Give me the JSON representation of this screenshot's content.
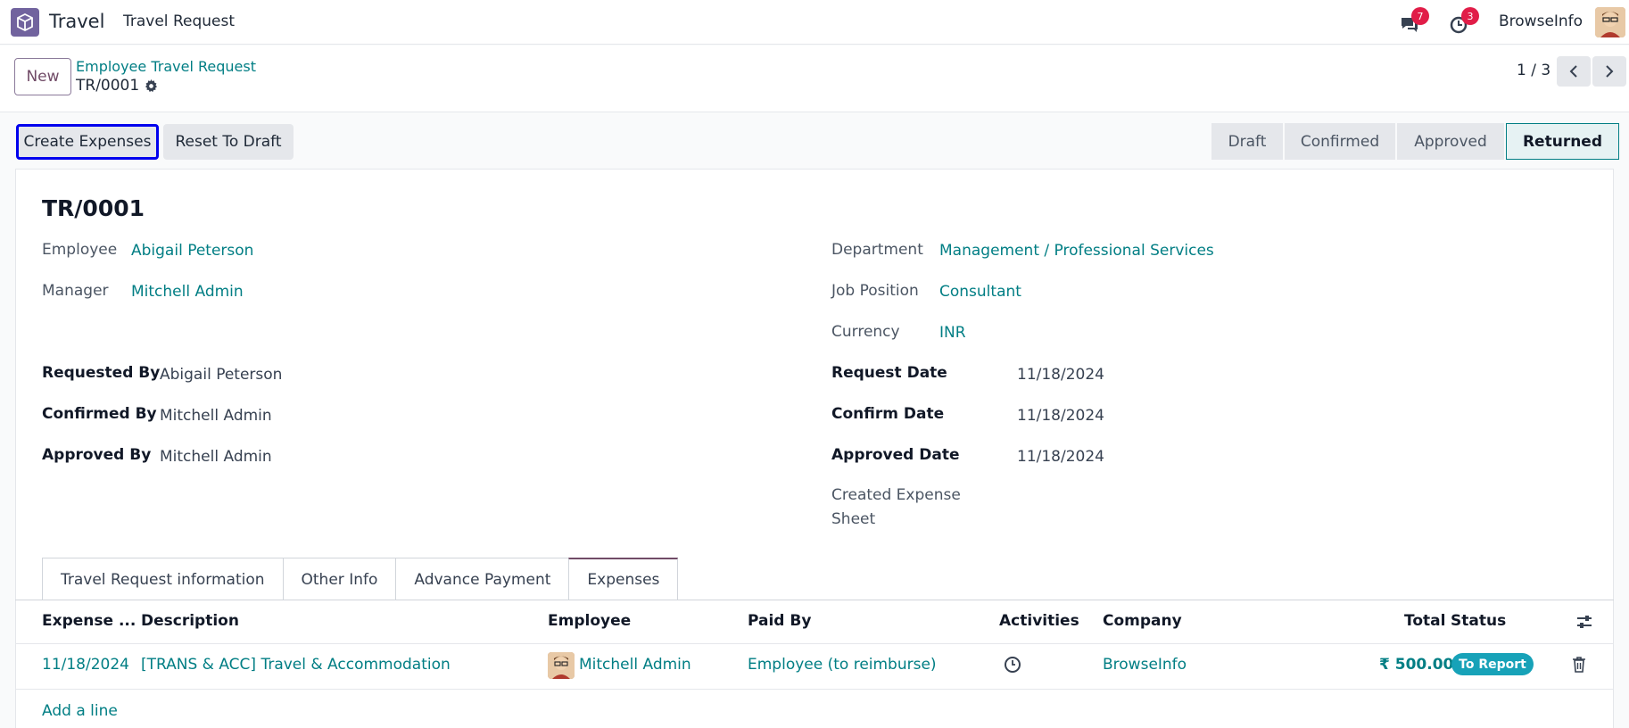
{
  "navbar": {
    "app_name": "Travel",
    "menu_item": "Travel Request",
    "messages_badge": "7",
    "activities_badge": "3",
    "company": "BrowseInfo"
  },
  "control_panel": {
    "new_label": "New",
    "breadcrumb_parent": "Employee Travel Request",
    "breadcrumb_current": "TR/0001",
    "pager": "1 / 3"
  },
  "actions": {
    "create_expenses": "Create Expenses",
    "reset_to_draft": "Reset To Draft"
  },
  "statusbar": {
    "stages": [
      "Draft",
      "Confirmed",
      "Approved",
      "Returned"
    ],
    "active": "Returned"
  },
  "form": {
    "title": "TR/0001",
    "employee_label": "Employee",
    "employee": "Abigail Peterson",
    "manager_label": "Manager",
    "manager": "Mitchell Admin",
    "department_label": "Department",
    "department": "Management / Professional Services",
    "job_position_label": "Job Position",
    "job_position": "Consultant",
    "currency_label": "Currency",
    "currency": "INR",
    "requested_by_label": "Requested By",
    "requested_by": "Abigail Peterson",
    "confirmed_by_label": "Confirmed By",
    "confirmed_by": "Mitchell Admin",
    "approved_by_label": "Approved By",
    "approved_by": "Mitchell Admin",
    "request_date_label": "Request Date",
    "request_date": "11/18/2024",
    "confirm_date_label": "Confirm Date",
    "confirm_date": "11/18/2024",
    "approved_date_label": "Approved Date",
    "approved_date": "11/18/2024",
    "created_sheet_label_1": "Created Expense",
    "created_sheet_label_2": "Sheet"
  },
  "tabs": [
    "Travel Request information",
    "Other Info",
    "Advance Payment",
    "Expenses"
  ],
  "active_tab": "Expenses",
  "table": {
    "headers": {
      "date": "Expense ...",
      "description": "Description",
      "employee": "Employee",
      "paid_by": "Paid By",
      "activities": "Activities",
      "company": "Company",
      "total": "Total",
      "status": "Status"
    },
    "rows": [
      {
        "date": "11/18/2024",
        "description": "[TRANS & ACC] Travel & Accommodation",
        "employee": "Mitchell Admin",
        "paid_by": "Employee (to reimburse)",
        "company": "BrowseInfo",
        "total": "₹ 500.00",
        "status": "To Report"
      }
    ],
    "add_line": "Add a line"
  },
  "colors": {
    "brand": "#714b67",
    "link": "#017e84",
    "status_pill": "#17a2b8",
    "badge": "#e11d48"
  }
}
